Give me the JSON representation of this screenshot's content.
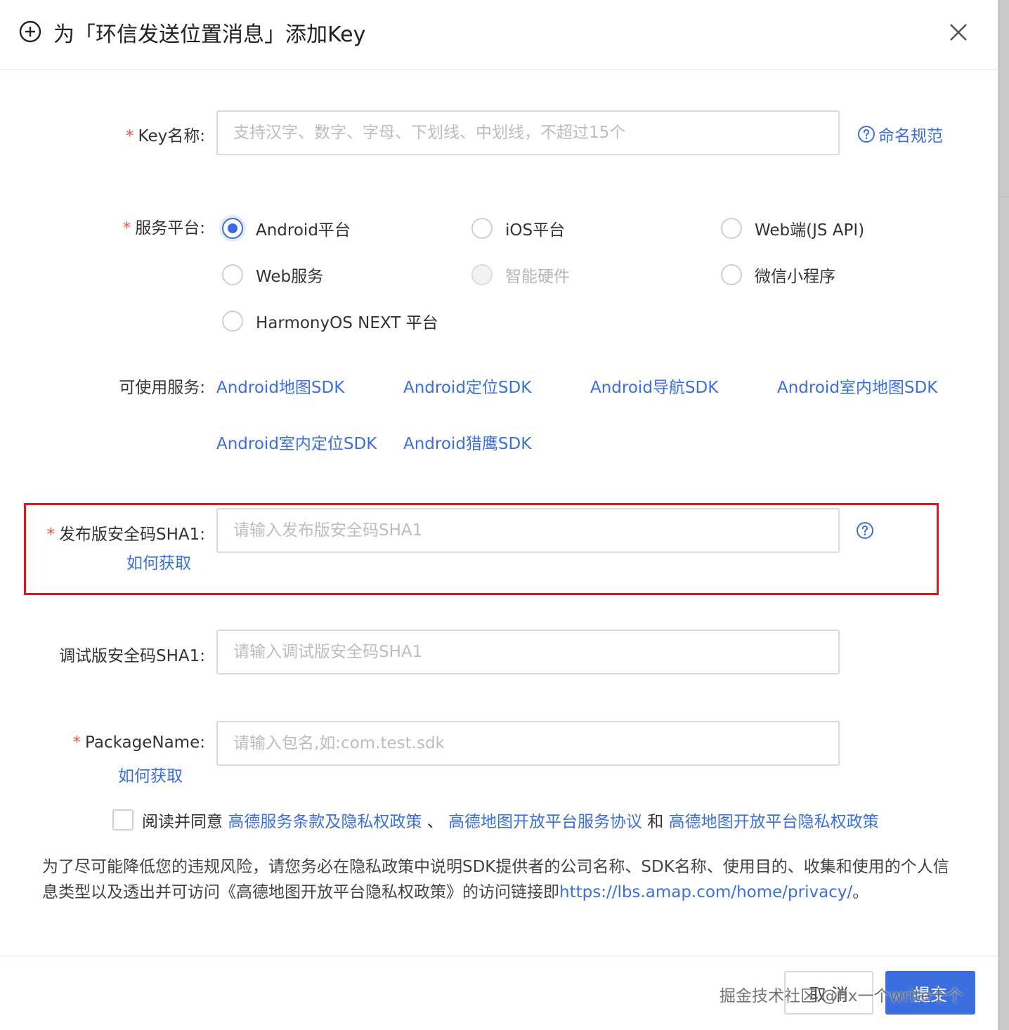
{
  "dialog": {
    "title": "为「环信发送位置消息」添加Key",
    "icon": "plus-circle-icon",
    "close_icon": "close-icon"
  },
  "form": {
    "key_name": {
      "required_mark": "*",
      "label": "Key名称:",
      "placeholder": "支持汉字、数字、字母、下划线、中划线，不超过15个",
      "help_label": "命名规范"
    },
    "platform": {
      "required_mark": "*",
      "label": "服务平台:",
      "options": [
        {
          "label": "Android平台",
          "checked": true,
          "disabled": false
        },
        {
          "label": "iOS平台",
          "checked": false,
          "disabled": false
        },
        {
          "label": "Web端(JS API)",
          "checked": false,
          "disabled": false
        },
        {
          "label": "Web服务",
          "checked": false,
          "disabled": false
        },
        {
          "label": "智能硬件",
          "checked": false,
          "disabled": true
        },
        {
          "label": "微信小程序",
          "checked": false,
          "disabled": false
        },
        {
          "label": "HarmonyOS NEXT 平台",
          "checked": false,
          "disabled": false
        }
      ]
    },
    "services": {
      "label": "可使用服务:",
      "items": [
        "Android地图SDK",
        "Android定位SDK",
        "Android导航SDK",
        "Android室内地图SDK",
        "Android室内定位SDK",
        "Android猎鹰SDK"
      ]
    },
    "release_sha1": {
      "required_mark": "*",
      "label": "发布版安全码SHA1:",
      "how_to": "如何获取",
      "placeholder": "请输入发布版安全码SHA1"
    },
    "debug_sha1": {
      "label": "调试版安全码SHA1:",
      "placeholder": "请输入调试版安全码SHA1"
    },
    "package_name": {
      "required_mark": "*",
      "label": "PackageName:",
      "how_to": "如何获取",
      "placeholder": "请输入包名,如:com.test.sdk"
    },
    "agreement": {
      "prefix": "阅读并同意",
      "link1": "高德服务条款及隐私权政策",
      "sep1": "、",
      "link2": "高德地图开放平台服务协议",
      "sep2": "和",
      "link3": "高德地图开放平台隐私权政策"
    },
    "notice": {
      "text": "为了尽可能降低您的违规风险，请您务必在隐私政策中说明SDK提供者的公司名称、SDK名称、使用目的、收集和使用的个人信息类型以及透出并可访问《高德地图开放平台隐私权政策》的访问链接即",
      "link": "https://lbs.amap.com/home/privacy/",
      "suffix": "。"
    }
  },
  "footer": {
    "cancel_label": "取 消",
    "submit_label": "提交",
    "watermark": "掘金技术社区 @fix一个write十个"
  },
  "colors": {
    "accent": "#3b6fe0",
    "required": "#f5533d",
    "highlight_border": "#e8151b"
  }
}
